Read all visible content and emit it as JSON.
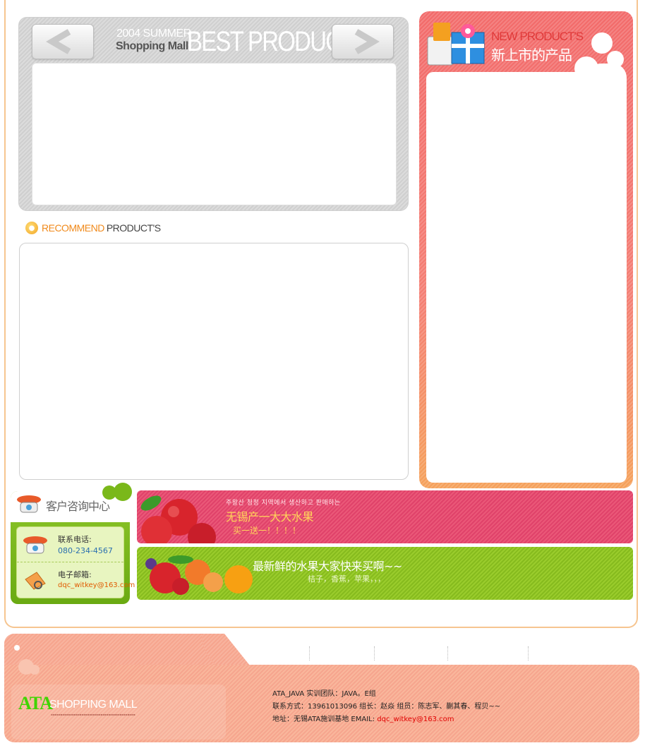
{
  "best_product": {
    "year_label": "2004 SUMMER",
    "mall_label": "Shopping Mall",
    "title": "BEST PRODUCT",
    "prev_icon": "arrow-left-icon",
    "next_icon": "arrow-right-icon"
  },
  "recommend": {
    "title_accent": "RECOMMEND",
    "title_rest": "PRODUCT'S"
  },
  "new_product": {
    "title_en": "NEW PRODUCT'S",
    "title_cn": "新上市的产品",
    "icon": "gift-box-icon"
  },
  "customer_service": {
    "title": "客户咨询中心",
    "phone_label": "联系电话:",
    "phone_value": "080-234-4567",
    "email_label": "电子邮箱:",
    "email_value": "dqc_witkey@163.com",
    "title_icon": "telephone-icon",
    "phone_icon": "telephone-icon",
    "email_icon": "envelope-icon"
  },
  "banners": {
    "red": {
      "small_text": "주왕산 청정 지역에서 생산하고 판매하는",
      "main_text": "无锡产一大大水果",
      "sub_text": "买一送一！！！！",
      "image_icon": "apples-icon"
    },
    "green": {
      "main_text": "最新鲜的水果大家快来买啊~~",
      "sub_text": "桔子，香蕉，苹果，，，",
      "image_icon": "fruit-basket-icon"
    }
  },
  "footer": {
    "logo_ata": "ATA",
    "logo_mall": "SHOPPING MALL",
    "line1": "ATA_JAVA 实训团队：JAVA。E组",
    "line2": "联系方式：13961013096    组长：赵焱   组员：陈志军、蒯其春、程贝~~",
    "line3_prefix": "地址：无锡ATA施训基地     EMAIL: ",
    "line3_email": "dqc_witkey@163.com"
  },
  "colors": {
    "accent_orange": "#f08a1c",
    "new_red": "#f26a6a",
    "cs_green": "#7ab81a",
    "banner_pink": "#e0426a",
    "banner_green": "#8ec225",
    "footer_peach": "#f8b39e"
  }
}
